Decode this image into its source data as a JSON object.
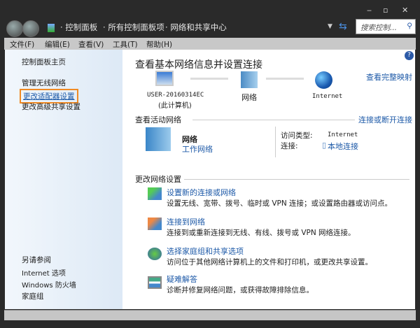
{
  "window": {
    "minimize": "‒",
    "maximize": "▫",
    "close": "✕"
  },
  "address": {
    "crumbs": [
      "控制面板",
      "所有控制面板项",
      "网络和共享中心"
    ],
    "search_placeholder": "搜索控制... "
  },
  "menu": [
    "文件(F)",
    "编辑(E)",
    "查看(V)",
    "工具(T)",
    "帮助(H)"
  ],
  "sidebar": {
    "home": "控制面板主页",
    "items": [
      "管理无线网络",
      "更改适配器设置",
      "更改高级共享设置"
    ],
    "selected": "更改适配器设置",
    "see_also_title": "另请参阅",
    "see_also": [
      "Internet 选项",
      "Windows 防火墙",
      "家庭组"
    ]
  },
  "main": {
    "title": "查看基本网络信息并设置连接",
    "view_full_map": "查看完整映射",
    "map": {
      "computer": "USER-20160314EC",
      "computer_sub": "(此计算机)",
      "network": "网络",
      "internet": "Internet"
    },
    "active_title": "查看活动网络",
    "connect_disconnect": "连接或断开连接",
    "active": {
      "name": "网络",
      "type": "工作网络",
      "access_label": "访问类型:",
      "access_value": "Internet",
      "conn_label": "连接:",
      "conn_value": "本地连接"
    },
    "change_title": "更改网络设置",
    "items": [
      {
        "icon": "new-connection-icon",
        "title": "设置新的连接或网络",
        "desc": "设置无线、宽带、拨号、临时或 VPN 连接；或设置路由器或访问点。"
      },
      {
        "icon": "connect-network-icon",
        "title": "连接到网络",
        "desc": "连接到或重新连接到无线、有线、拨号或 VPN 网络连接。"
      },
      {
        "icon": "homegroup-icon",
        "title": "选择家庭组和共享选项",
        "desc": "访问位于其他网络计算机上的文件和打印机，或更改共享设置。"
      },
      {
        "icon": "troubleshoot-icon",
        "title": "疑难解答",
        "desc": "诊断并修复网络问题，或获得故障排除信息。"
      }
    ]
  },
  "colors": {
    "link": "#1e5aa8",
    "highlight": "#f08a24"
  }
}
